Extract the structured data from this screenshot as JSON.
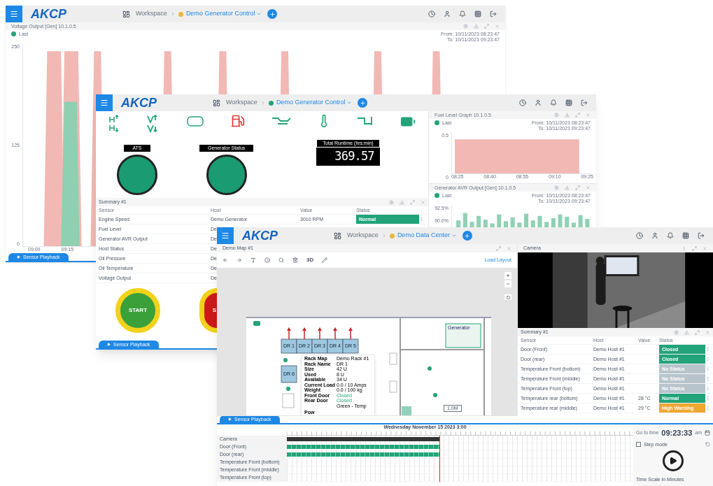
{
  "windows": [
    {
      "logo": "AKCP",
      "workspace": "Workspace",
      "dashboard": "Demo Generator Control",
      "color": "#f0b43c",
      "panel": {
        "title": "Voltage Output [Gen] 10.1.0.5",
        "legend": "Last",
        "range": [
          "From: 10/11/2023 08:23:47",
          "To: 10/11/2023 09:23:47"
        ],
        "y_ticks": [
          "250",
          "125",
          "0"
        ],
        "x_ticks": [
          "09:00",
          "09:15"
        ]
      },
      "playback": "Sensor Playback"
    },
    {
      "logo": "AKCP",
      "workspace": "Workspace",
      "dashboard": "Demo Generator Control",
      "color": "#22a37a",
      "indicators": [
        {
          "label": "ATS"
        },
        {
          "label": "Generator Status"
        }
      ],
      "runtime": {
        "label": "Total Runtime (hrs:min)",
        "value": "369.57"
      },
      "summary": {
        "title": "Summary #1",
        "columns": [
          "Sensor",
          "Host",
          "Value",
          "Status"
        ],
        "rows": [
          {
            "sensor": "Engine Speed",
            "host": "Demo Generator",
            "value": "3010 RPM",
            "status": "Normal",
            "color": "#22a37a"
          },
          {
            "sensor": "Fuel Level",
            "host": "De"
          },
          {
            "sensor": "Generator AVR Output",
            "host": "De"
          },
          {
            "sensor": "Host Status",
            "host": "De"
          },
          {
            "sensor": "Oil Pressure",
            "host": "De"
          },
          {
            "sensor": "Oil Temperature",
            "host": "De"
          },
          {
            "sensor": "Voltage Output",
            "host": "De"
          }
        ]
      },
      "start_label": "START",
      "stop_label": "S",
      "side_panels": [
        {
          "kind": "area",
          "title": "Fuel Level Graph 10.1.0.5",
          "legend": "Last",
          "range": [
            "From: 10/11/2023 08:23:47",
            "To: 10/11/2023 09:23:47"
          ],
          "y_ticks": [
            "0.5",
            "0"
          ],
          "x_ticks": [
            "08:25",
            "08:40",
            "08:55",
            "09:10",
            "09:25"
          ]
        },
        {
          "kind": "bars",
          "title": "Generator AVR Output [Gen] 10.1.0.5",
          "legend": "Last",
          "range": [
            "From: 10/11/2023 08:23:47",
            "To: 10/11/2023 09:23:47"
          ],
          "y_ticks": [
            "92.5%",
            "90.0%"
          ]
        }
      ],
      "playback": "Sensor Playback"
    },
    {
      "logo": "AKCP",
      "workspace": "Workspace",
      "dashboard": "Demo Data Center",
      "color": "#f0b43c",
      "map": {
        "title": "Demo Map #1",
        "tool_label": "3D",
        "link": "Load Layout",
        "room_label": "Generator",
        "racks": [
          "DR 1",
          "DR 2",
          "DR 3",
          "DR 4",
          "DR 5"
        ],
        "lower_rack": "DR 6",
        "scale_label": "1.0M",
        "tooltip": [
          {
            "key": "Rack Map",
            "value": "Demo Rack #1"
          },
          {
            "key": "Rack Name",
            "value": "DR 1"
          },
          {
            "key": "Size",
            "value": "42 U"
          },
          {
            "key": "Used",
            "value": "8 U"
          },
          {
            "key": "Available",
            "value": "34 U"
          },
          {
            "key": "Current Load",
            "value": "0.0 / 10 Amps"
          },
          {
            "key": "Weight",
            "value": "0.0 / 100 kg"
          },
          {
            "key": "Front Door",
            "value": "Closed"
          },
          {
            "key": "Rear Door",
            "value": "Closed"
          },
          {
            "value": "Green - Temp"
          }
        ],
        "tooltip_more": "Pow"
      },
      "camera": {
        "title": "Camera"
      },
      "summary": {
        "title": "Summary #1",
        "columns": [
          "Sensor",
          "Host",
          "Value",
          "Status"
        ],
        "rows": [
          {
            "sensor": "Door (Front)",
            "host": "Demo Host #1",
            "status": "Closed",
            "color": "#22a37a"
          },
          {
            "sensor": "Door (rear)",
            "host": "Demo Host #1",
            "status": "Closed",
            "color": "#22a37a"
          },
          {
            "sensor": "Temperature Front (bottom)",
            "host": "Demo Host #1",
            "status": "No Status",
            "color": "#b8c4cc"
          },
          {
            "sensor": "Temperature Front (middle)",
            "host": "Demo Host #1",
            "status": "No Status",
            "color": "#b8c4cc"
          },
          {
            "sensor": "Temperature Front (top)",
            "host": "Demo Host #1",
            "status": "No Status",
            "color": "#b8c4cc"
          },
          {
            "sensor": "Temperature rear (bottom)",
            "host": "Demo Host #1",
            "value": "28 °C",
            "status": "Normal",
            "color": "#22a37a"
          },
          {
            "sensor": "Temperature rear (middle)",
            "host": "Demo Host #1",
            "value": "29 °C",
            "status": "High Warning",
            "color": "#f0a830"
          }
        ]
      },
      "playback": {
        "tab": "Sensor Playback",
        "date": "Wednesday November 15 2023 3:00",
        "level": 0.44,
        "rows": [
          {
            "name": "Camera",
            "kind": "camera"
          },
          {
            "name": "Door (Front)",
            "kind": "sensor"
          },
          {
            "name": "Door (rear)",
            "kind": "sensor"
          },
          {
            "name": "Temperature Front (bottom)",
            "kind": "none"
          },
          {
            "name": "Temperature Front (middle)",
            "kind": "none"
          },
          {
            "name": "Temperature Front (top)",
            "kind": "none"
          }
        ],
        "goto_label": "Go to time",
        "time": "09:23:33",
        "ampm": "am",
        "step_mode": {
          "label": "Step mode",
          "checked": false
        },
        "scale": "Time Scale in Minutes"
      }
    }
  ]
}
